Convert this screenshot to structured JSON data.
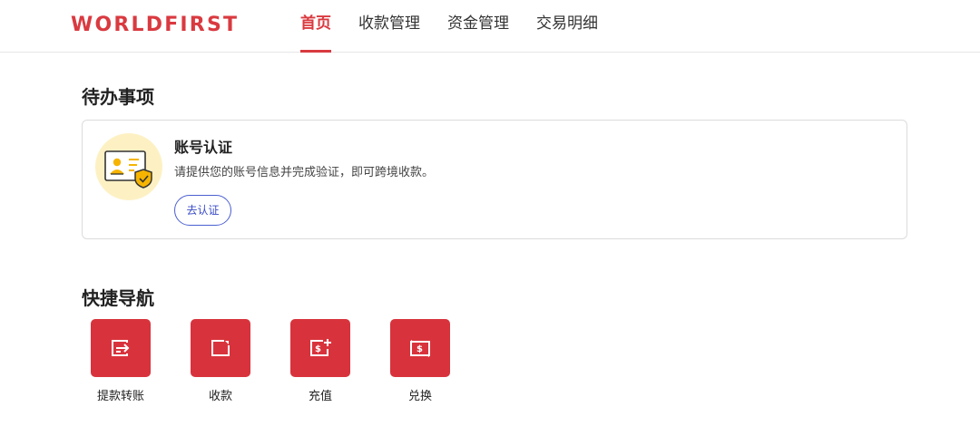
{
  "header": {
    "logo_text": "WORLDFIRST",
    "nav": [
      {
        "label": "首页",
        "active": true
      },
      {
        "label": "收款管理",
        "active": false
      },
      {
        "label": "资金管理",
        "active": false
      },
      {
        "label": "交易明细",
        "active": false
      }
    ]
  },
  "todo": {
    "section_title": "待办事项",
    "card": {
      "icon": "id-card-shield-icon",
      "title": "账号认证",
      "description": "请提供您的账号信息并完成验证，即可跨境收款。",
      "button_label": "去认证"
    }
  },
  "shortcuts": {
    "section_title": "快捷导航",
    "items": [
      {
        "label": "提款转账",
        "icon": "withdraw-transfer-icon"
      },
      {
        "label": "收款",
        "icon": "receive-icon"
      },
      {
        "label": "充值",
        "icon": "top-up-icon"
      },
      {
        "label": "兑换",
        "icon": "exchange-icon"
      }
    ]
  },
  "colors": {
    "brand_red": "#d93a40",
    "tile_red": "#d8333c",
    "button_blue": "#3a4cc7",
    "illustration_yellow": "#fdf1c4"
  }
}
